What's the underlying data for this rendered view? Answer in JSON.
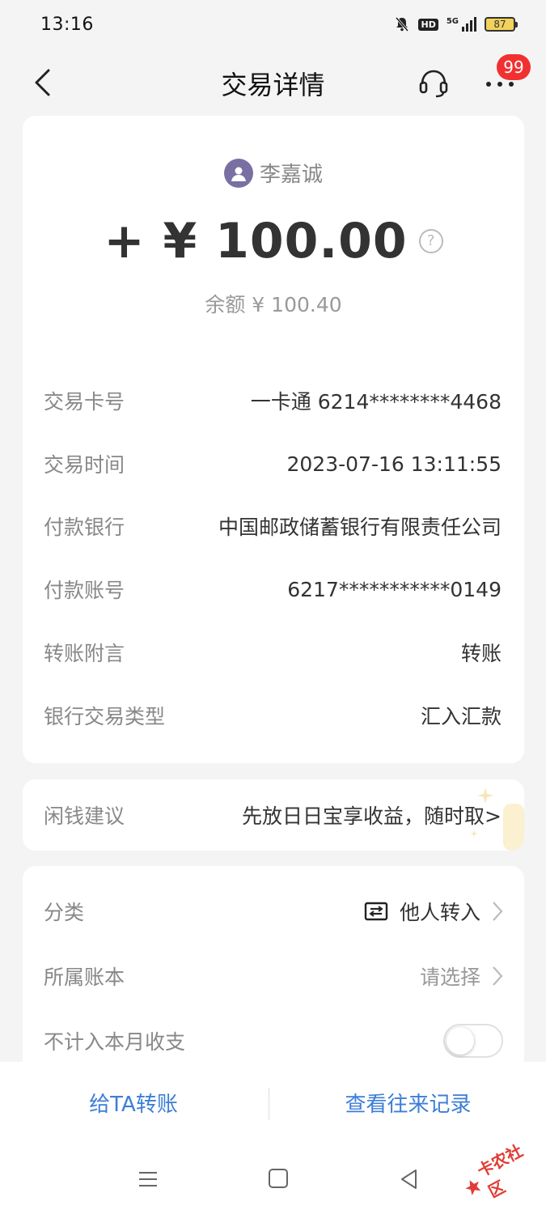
{
  "status_bar": {
    "time": "13:16",
    "hd_label": "HD",
    "network_label": "5G",
    "battery_level": "87"
  },
  "nav": {
    "title": "交易详情",
    "badge_count": "99"
  },
  "transaction": {
    "payer_name": "李嘉诚",
    "amount": "+ ¥ 100.00",
    "help_symbol": "?",
    "balance": "余额 ¥ 100.40",
    "details": [
      {
        "label": "交易卡号",
        "value": "一卡通 6214********4468"
      },
      {
        "label": "交易时间",
        "value": "2023-07-16 13:11:55"
      },
      {
        "label": "付款银行",
        "value": "中国邮政储蓄银行有限责任公司"
      },
      {
        "label": "付款账号",
        "value": "6217***********0149"
      },
      {
        "label": "转账附言",
        "value": "转账"
      },
      {
        "label": "银行交易类型",
        "value": "汇入汇款"
      }
    ]
  },
  "idle_money": {
    "label": "闲钱建议",
    "value": "先放日日宝享收益，随时取>"
  },
  "classification": {
    "category_label": "分类",
    "category_value": "他人转入",
    "ledger_label": "所属账本",
    "ledger_value": "请选择",
    "exclude_label": "不计入本月收支",
    "exclude_enabled": false
  },
  "actions": {
    "transfer_label": "给TA转账",
    "history_label": "查看往来记录"
  },
  "watermark": {
    "text": "卡农社区"
  },
  "colors": {
    "accent_blue": "#3d7ed6",
    "badge_red": "#f23030",
    "avatar_purple": "#7a6fa3"
  }
}
